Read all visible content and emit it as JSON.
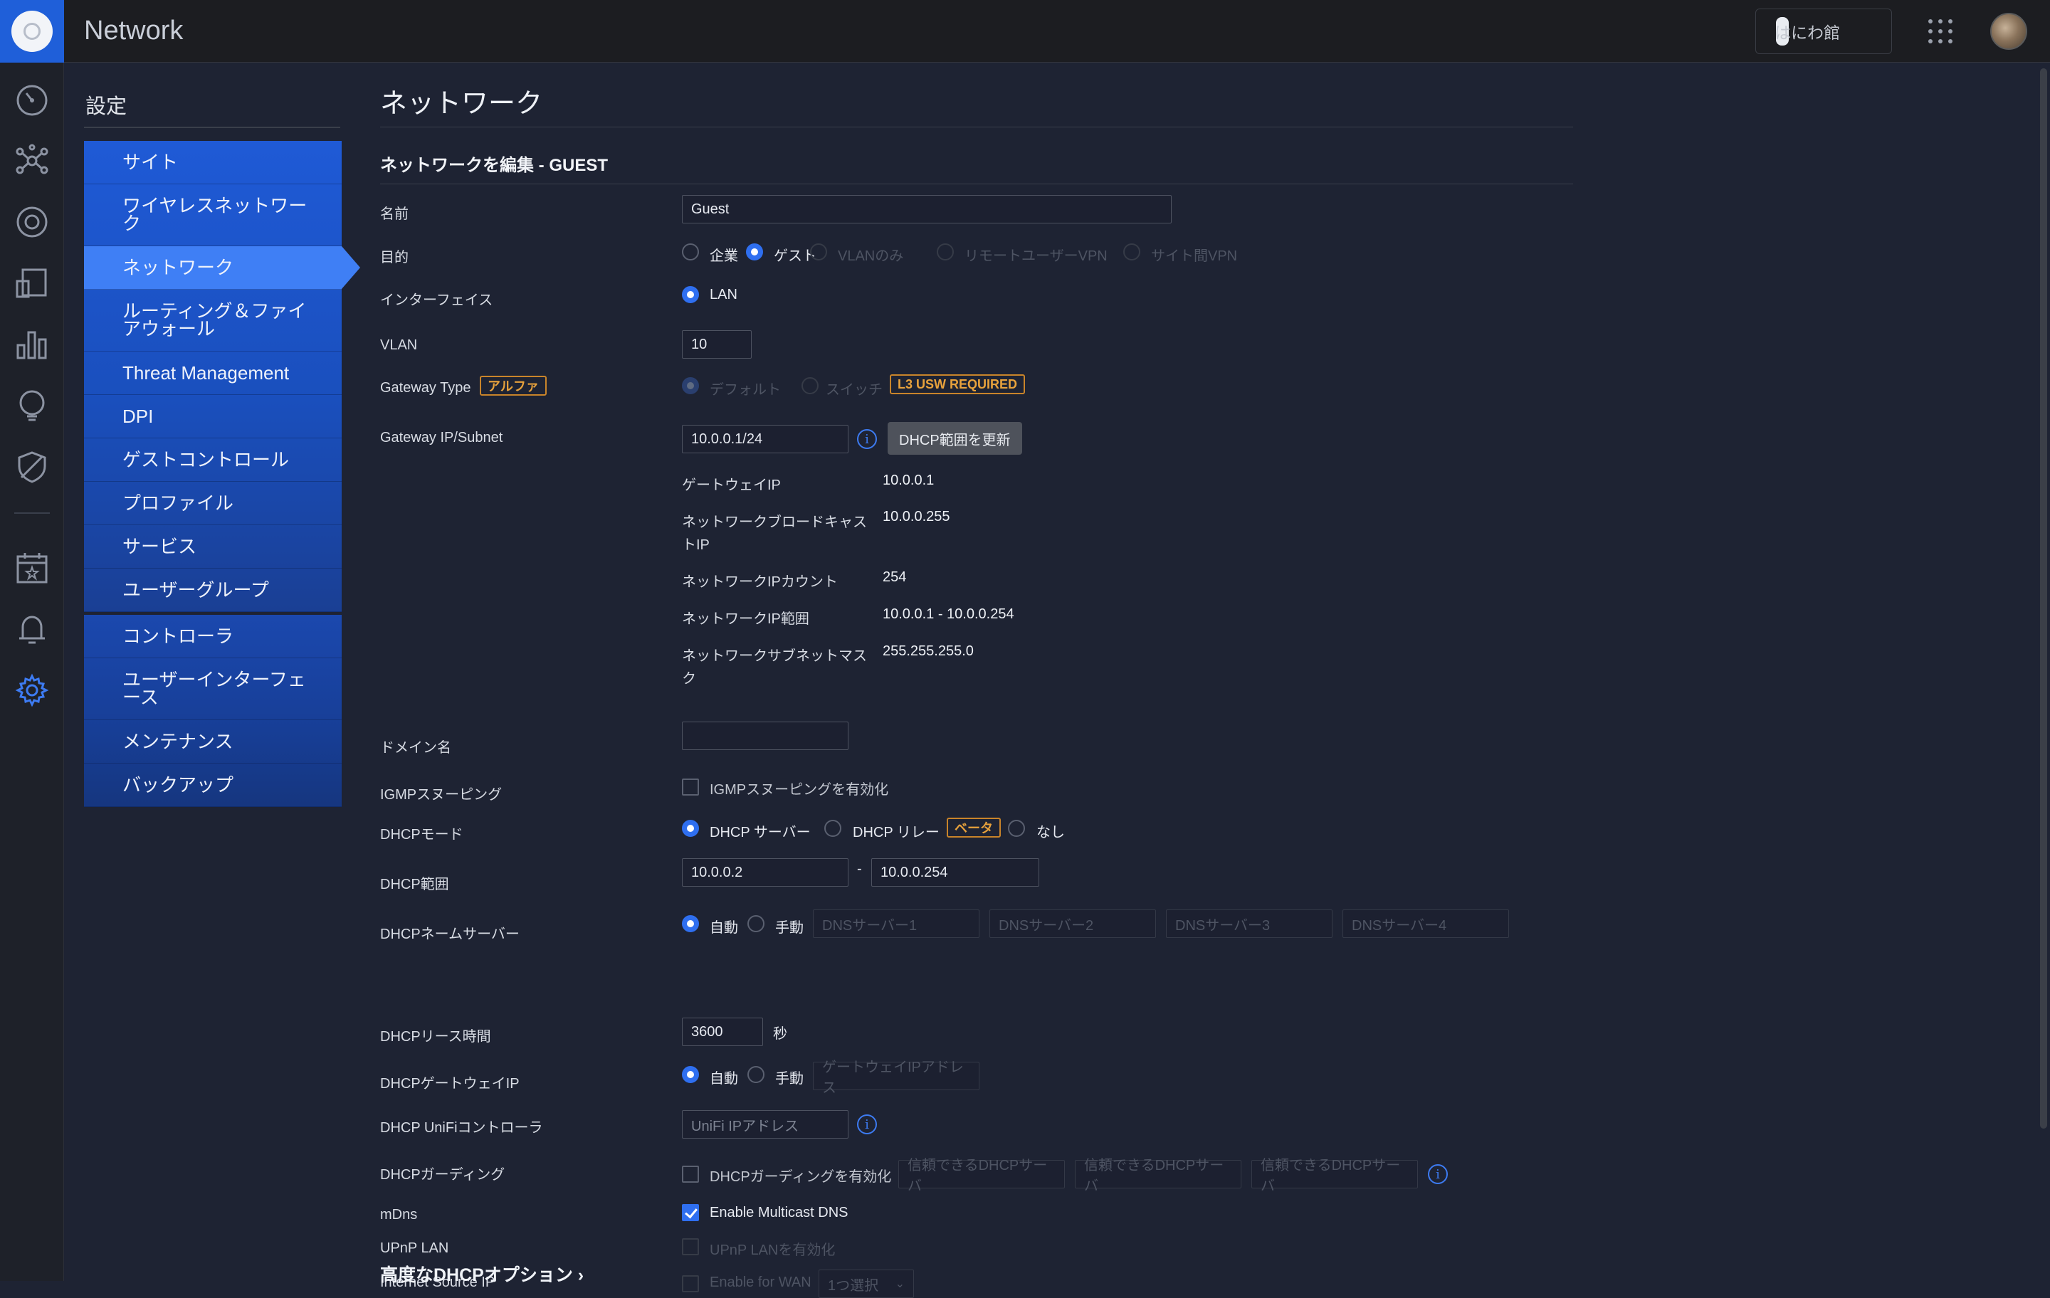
{
  "topbar": {
    "title": "Network",
    "site_name": "はにわ館"
  },
  "nav": {
    "title": "設定",
    "group1": [
      {
        "label": "サイト"
      },
      {
        "label": "ワイヤレスネットワーク"
      },
      {
        "label": "ネットワーク",
        "active": true
      },
      {
        "label": "ルーティング＆ファイアウォール"
      },
      {
        "label": "Threat Management"
      },
      {
        "label": "DPI"
      },
      {
        "label": "ゲストコントロール"
      },
      {
        "label": "プロファイル"
      },
      {
        "label": "サービス"
      },
      {
        "label": "ユーザーグループ"
      }
    ],
    "group2": [
      {
        "label": "コントローラ"
      },
      {
        "label": "ユーザーインターフェース"
      },
      {
        "label": "メンテナンス"
      },
      {
        "label": "バックアップ"
      }
    ]
  },
  "page": {
    "title": "ネットワーク",
    "section_title": "ネットワークを編集 - GUEST"
  },
  "form": {
    "name": {
      "label": "名前",
      "value": "Guest"
    },
    "purpose": {
      "label": "目的",
      "options": [
        "企業",
        "ゲスト",
        "VLANのみ",
        "リモートユーザーVPN",
        "サイト間VPN"
      ],
      "selected": "ゲスト"
    },
    "interface": {
      "label": "インターフェイス",
      "value": "LAN"
    },
    "vlan": {
      "label": "VLAN",
      "value": "10"
    },
    "gateway_type": {
      "label": "Gateway Type",
      "badge": "アルファ",
      "options": [
        "デフォルト",
        "スイッチ"
      ],
      "selected": "デフォルト",
      "warning": "L3 USW REQUIRED"
    },
    "gateway_subnet": {
      "label": "Gateway IP/Subnet",
      "value": "10.0.0.1/24",
      "update_button": "DHCP範囲を更新"
    },
    "details": [
      {
        "label": "ゲートウェイIP",
        "value": "10.0.0.1"
      },
      {
        "label": "ネットワークブロードキャストIP",
        "value": "10.0.0.255"
      },
      {
        "label": "ネットワークIPカウント",
        "value": "254"
      },
      {
        "label": "ネットワークIP範囲",
        "value": "10.0.0.1 - 10.0.0.254"
      },
      {
        "label": "ネットワークサブネットマスク",
        "value": "255.255.255.0"
      }
    ],
    "domain": {
      "label": "ドメイン名",
      "value": ""
    },
    "igmp": {
      "label": "IGMPスヌーピング",
      "checkbox": "IGMPスヌーピングを有効化",
      "checked": false
    },
    "dhcp_mode": {
      "label": "DHCPモード",
      "options": [
        "DHCP サーバー",
        "DHCP リレー",
        "なし"
      ],
      "selected": "DHCP サーバー",
      "badge": "ベータ"
    },
    "dhcp_range": {
      "label": "DHCP範囲",
      "start": "10.0.0.2",
      "sep": "-",
      "end": "10.0.0.254"
    },
    "dhcp_ns": {
      "label": "DHCPネームサーバー",
      "options": [
        "自動",
        "手動"
      ],
      "selected": "自動",
      "placeholders": [
        "DNSサーバー1",
        "DNSサーバー2",
        "DNSサーバー3",
        "DNSサーバー4"
      ]
    },
    "dhcp_lease": {
      "label": "DHCPリース時間",
      "value": "3600",
      "unit": "秒"
    },
    "dhcp_gw": {
      "label": "DHCPゲートウェイIP",
      "options": [
        "自動",
        "手動"
      ],
      "selected": "自動",
      "placeholder": "ゲートウェイIPアドレス"
    },
    "dhcp_unifi": {
      "label": "DHCP UniFiコントローラ",
      "placeholder": "UniFi IPアドレス"
    },
    "dhcp_guard": {
      "label": "DHCPガーディング",
      "checkbox": "DHCPガーディングを有効化",
      "checked": false,
      "placeholders": [
        "信頼できるDHCPサーバ",
        "信頼できるDHCPサーバ",
        "信頼できるDHCPサーバ"
      ]
    },
    "mdns": {
      "label": "mDns",
      "checkbox": "Enable Multicast DNS",
      "checked": true
    },
    "upnp": {
      "label": "UPnP LAN",
      "checkbox": "UPnP LANを有効化",
      "checked": false
    },
    "isip": {
      "label": "Internet Source IP",
      "checkbox": "Enable for WAN",
      "select": "1つ選択"
    },
    "advanced": "高度なDHCPオプション"
  },
  "colors": {
    "accent": "#2f6ff0",
    "nav_active": "#3f7ff5",
    "badge": "#e8a23c",
    "background": "#1e2333"
  }
}
